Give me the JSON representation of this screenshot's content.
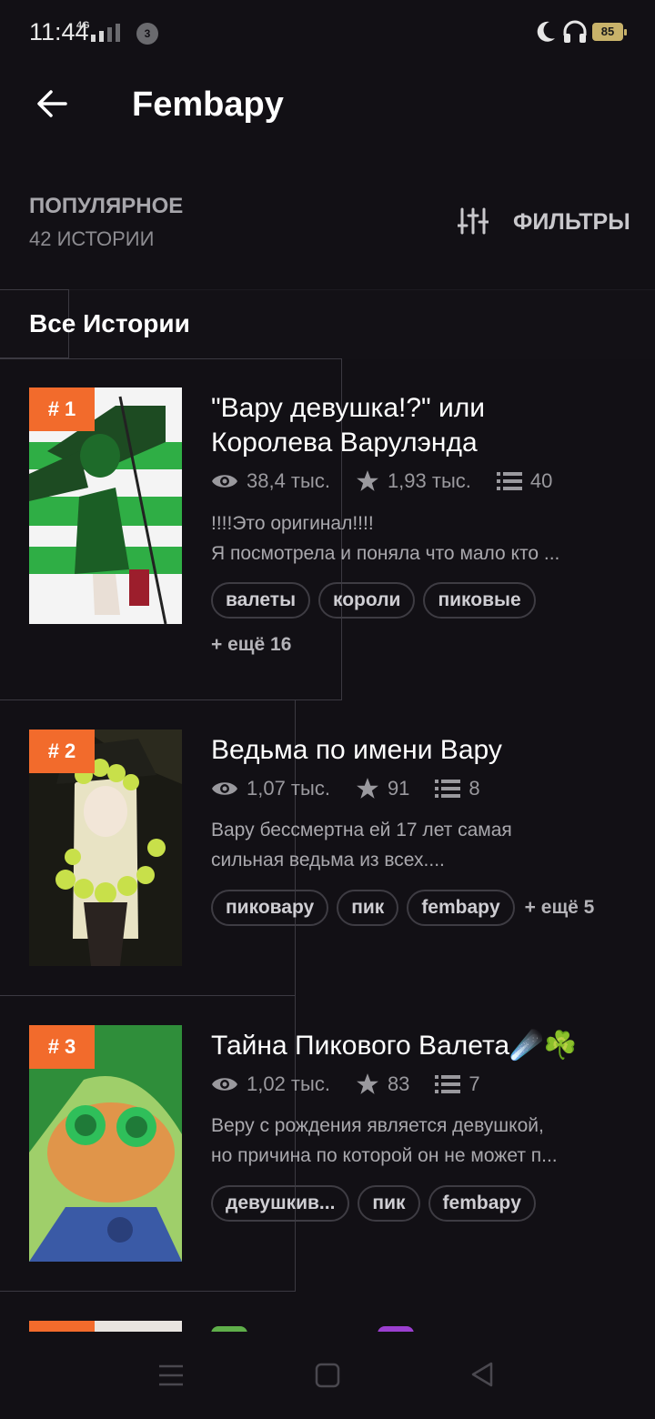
{
  "status_bar": {
    "time": "11:44",
    "network": "4G",
    "notification_count": "3",
    "battery": "85"
  },
  "app_bar": {
    "title": "Fembapy"
  },
  "sort": {
    "label": "ПОПУЛЯРНОЕ",
    "count": "42 ИСТОРИИ",
    "filter_label": "ФИЛЬТРЫ"
  },
  "section": {
    "title": "Все Истории"
  },
  "stories": [
    {
      "rank": "# 1",
      "title_lines": [
        "\"Вару девушка!?\" или",
        "Королева Варулэнда"
      ],
      "views": "38,4 тыс.",
      "votes": "1,93 тыс.",
      "parts": "40",
      "desc_lines": [
        "!!!!Это оригинал!!!!",
        "Я посмотрела и поняла что мало кто ..."
      ],
      "tags": [
        "валеты",
        "короли",
        "пиковые"
      ],
      "more": "+ ещё 16"
    },
    {
      "rank": "# 2",
      "title_lines": [
        "Ведьма по имени Вару"
      ],
      "views": "1,07 тыс.",
      "votes": "91",
      "parts": "8",
      "desc_lines": [
        "Вару бессмертна ей 17 лет самая",
        "сильная ведьма из всех...."
      ],
      "tags": [
        "пиковару",
        "пик",
        "fembapy"
      ],
      "more": "+ ещё 5"
    },
    {
      "rank": "# 3",
      "title_lines": [
        "Тайна Пикового Валета☄️☘️"
      ],
      "views": "1,02 тыс.",
      "votes": "83",
      "parts": "7",
      "desc_lines": [
        "Веру с рождения является девушкой,",
        "но причина по которой он не может п..."
      ],
      "tags": [
        "девушкив...",
        "пик",
        "fembapy"
      ]
    }
  ],
  "colors": {
    "background": "#121015",
    "accent_rank": "#f26b2c",
    "tag_border": "#3e3c43"
  },
  "icons": [
    "back-arrow-icon",
    "sliders-icon",
    "eye-icon",
    "star-icon",
    "list-icon",
    "moon-icon",
    "headphones-icon",
    "signal-icon",
    "menu-icon",
    "home-square-icon",
    "back-triangle-icon"
  ]
}
